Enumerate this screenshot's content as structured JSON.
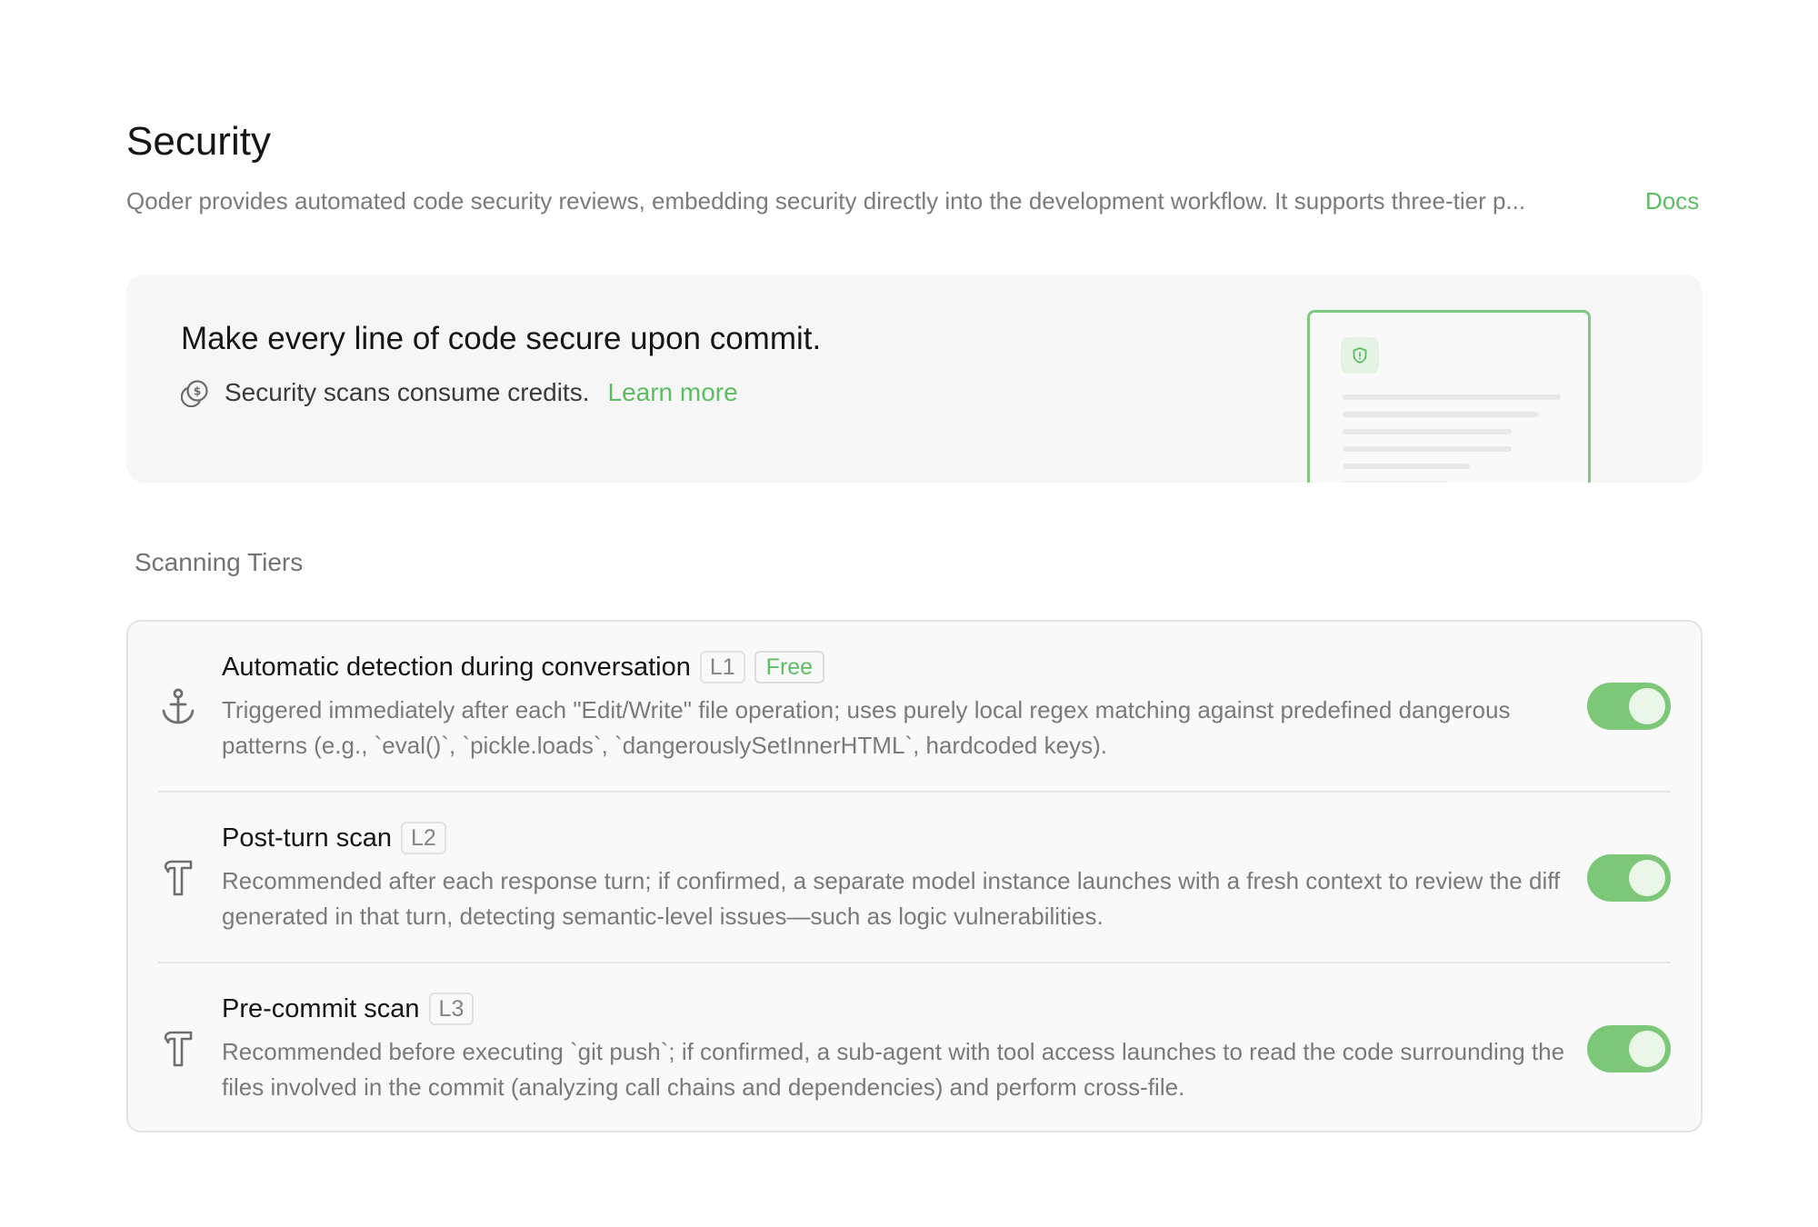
{
  "page": {
    "title": "Security",
    "subtitle": "Qoder provides automated code security reviews, embedding security directly into the development workflow. It supports three-tier p...",
    "docs_link": "Docs"
  },
  "banner": {
    "headline": "Make every line of code secure upon commit.",
    "credits_text": "Security scans consume credits.",
    "learn_more": "Learn more",
    "icon": "coin-icon",
    "illustration_icon": "shield-icon"
  },
  "section": {
    "label": "Scanning Tiers"
  },
  "tiers": [
    {
      "title": "Automatic detection during conversation",
      "level": "L1",
      "badge": "Free",
      "description": "Triggered immediately after each \"Edit/Write\" file operation; uses purely local regex matching against predefined dangerous patterns (e.g., `eval()`, `pickle.loads`, `dangerouslySetInnerHTML`, hardcoded keys).",
      "icon": "anchor-icon",
      "enabled": true
    },
    {
      "title": "Post-turn scan",
      "level": "L2",
      "description": "Recommended after each response turn; if confirmed, a separate model instance launches with a fresh context to review the diff generated in that turn, detecting semantic-level issues—such as logic vulnerabilities.",
      "icon": "hammer-icon",
      "enabled": true
    },
    {
      "title": "Pre-commit scan",
      "level": "L3",
      "description": "Recommended before executing `git push`; if confirmed, a sub-agent with tool access launches to read the code surrounding the files involved in the commit (analyzing call chains and dependencies) and perform cross-file.",
      "icon": "hammer-icon",
      "enabled": true
    }
  ],
  "colors": {
    "accent": "#5dbd62",
    "toggle_on": "#7dc878",
    "banner_bg": "#f6f6f6"
  }
}
